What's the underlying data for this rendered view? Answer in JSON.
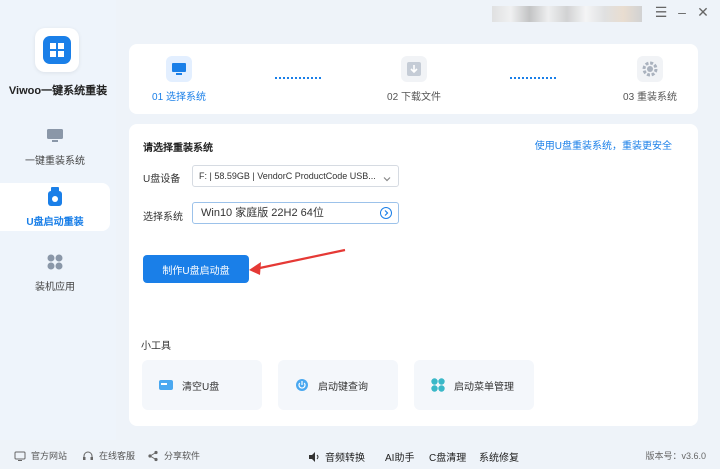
{
  "app": {
    "name": "Viwoo一键系统重装"
  },
  "sidebar": {
    "items": [
      {
        "label": "一键重装系统",
        "icon": "monitor-icon",
        "active": false
      },
      {
        "label": "U盘启动重装",
        "icon": "usb-drive-icon",
        "active": true
      },
      {
        "label": "装机应用",
        "icon": "apps-icon",
        "active": false
      }
    ]
  },
  "window_controls": {
    "menu": "☰",
    "minimize": "–",
    "close": "✕"
  },
  "steps": [
    {
      "label": "01 选择系统",
      "icon": "select-system-icon",
      "active": true
    },
    {
      "label": "02 下载文件",
      "icon": "download-icon",
      "active": false
    },
    {
      "label": "03 重装系统",
      "icon": "settings-gear-icon",
      "active": false
    }
  ],
  "main": {
    "section_title": "请选择重装系统",
    "safety_link": "使用U盘重装系统，重装更安全",
    "usb_device_label": "U盘设备",
    "usb_device_value": "F: | 58.59GB | VendorC ProductCode USB...",
    "system_label": "选择系统",
    "system_value": "Win10 家庭版 22H2 64位",
    "make_button": "制作U盘启动盘",
    "tools_title": "小工具",
    "tools": [
      {
        "label": "清空U盘",
        "icon": "clear-usb-icon"
      },
      {
        "label": "启动键查询",
        "icon": "power-key-icon"
      },
      {
        "label": "启动菜单管理",
        "icon": "boot-menu-icon"
      }
    ]
  },
  "bottom_bar": {
    "left": [
      {
        "label": "官方网站",
        "icon": "website-icon"
      },
      {
        "label": "在线客服",
        "icon": "headset-icon"
      },
      {
        "label": "分享软件",
        "icon": "share-icon"
      }
    ],
    "center": [
      {
        "label": "音频转换",
        "icon": "audio-convert-icon"
      },
      {
        "label": "AI助手"
      },
      {
        "label": "C盘清理"
      },
      {
        "label": "系统修复"
      }
    ],
    "version": "版本号：v3.6.0"
  },
  "colors": {
    "accent": "#1a7fe8",
    "background": "#eef3f9",
    "card": "#ffffff",
    "arrow": "#e53935"
  }
}
